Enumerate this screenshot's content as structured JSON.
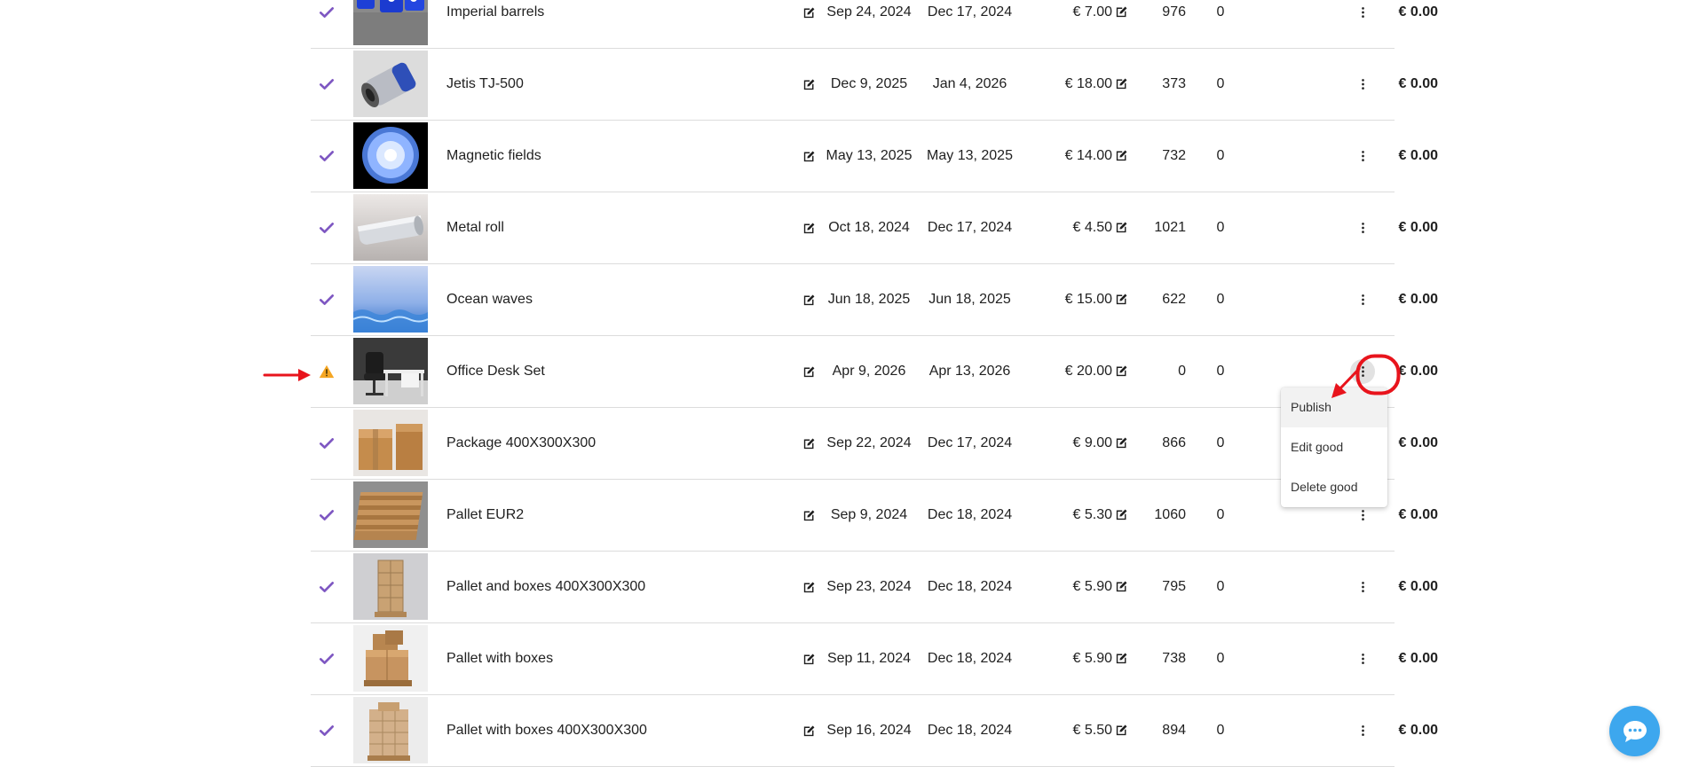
{
  "rows": [
    {
      "status": "published",
      "name": "Imperial barrels",
      "start": "Sep 24, 2024",
      "end": "Dec 17, 2024",
      "price": "€ 7.00",
      "qty": "976",
      "sold": "0",
      "total": "€ 0.00",
      "thumb": "imperial-barrels-thumbnail"
    },
    {
      "status": "published",
      "name": "Jetis TJ-500",
      "start": "Dec 9, 2025",
      "end": "Jan 4, 2026",
      "price": "€ 18.00",
      "qty": "373",
      "sold": "0",
      "total": "€ 0.00",
      "thumb": "jet-engine-thumbnail"
    },
    {
      "status": "published",
      "name": "Magnetic fields",
      "start": "May 13, 2025",
      "end": "May 13, 2025",
      "price": "€ 14.00",
      "qty": "732",
      "sold": "0",
      "total": "€ 0.00",
      "thumb": "magnetic-fields-thumbnail"
    },
    {
      "status": "published",
      "name": "Metal roll",
      "start": "Oct 18, 2024",
      "end": "Dec 17, 2024",
      "price": "€ 4.50",
      "qty": "1021",
      "sold": "0",
      "total": "€ 0.00",
      "thumb": "metal-roll-thumbnail"
    },
    {
      "status": "published",
      "name": "Ocean waves",
      "start": "Jun 18, 2025",
      "end": "Jun 18, 2025",
      "price": "€ 15.00",
      "qty": "622",
      "sold": "0",
      "total": "€ 0.00",
      "thumb": "ocean-waves-thumbnail"
    },
    {
      "status": "warning",
      "name": "Office Desk Set",
      "start": "Apr 9, 2026",
      "end": "Apr 13, 2026",
      "price": "€ 20.00",
      "qty": "0",
      "sold": "0",
      "total": "€ 0.00",
      "thumb": "office-desk-thumbnail"
    },
    {
      "status": "published",
      "name": "Package 400X300X300",
      "start": "Sep 22, 2024",
      "end": "Dec 17, 2024",
      "price": "€ 9.00",
      "qty": "866",
      "sold": "0",
      "total": "€ 0.00",
      "thumb": "package-boxes-thumbnail"
    },
    {
      "status": "published",
      "name": "Pallet EUR2",
      "start": "Sep 9, 2024",
      "end": "Dec 18, 2024",
      "price": "€ 5.30",
      "qty": "1060",
      "sold": "0",
      "total": "€ 0.00",
      "thumb": "pallet-thumbnail"
    },
    {
      "status": "published",
      "name": "Pallet and boxes 400X300X300",
      "start": "Sep 23, 2024",
      "end": "Dec 18, 2024",
      "price": "€ 5.90",
      "qty": "795",
      "sold": "0",
      "total": "€ 0.00",
      "thumb": "pallet-and-boxes-thumbnail"
    },
    {
      "status": "published",
      "name": "Pallet with boxes",
      "start": "Sep 11, 2024",
      "end": "Dec 18, 2024",
      "price": "€ 5.90",
      "qty": "738",
      "sold": "0",
      "total": "€ 0.00",
      "thumb": "pallet-with-boxes-thumbnail"
    },
    {
      "status": "published",
      "name": "Pallet with boxes 400X300X300",
      "start": "Sep 16, 2024",
      "end": "Dec 18, 2024",
      "price": "€ 5.50",
      "qty": "894",
      "sold": "0",
      "total": "€ 0.00",
      "thumb": "pallet-with-boxes-stack-thumbnail"
    }
  ],
  "context_menu": {
    "items": [
      "Publish",
      "Edit good",
      "Delete good"
    ],
    "open_on_row": 5
  },
  "colors": {
    "check": "#7e57c2",
    "warning": "#f5a623",
    "annotation": "#e8141c",
    "chat": "#3da7ee",
    "divider": "#dcdcdc"
  },
  "icons": {
    "status_published": "check-icon",
    "status_warning": "warning-icon",
    "edit": "edit-icon",
    "row_menu": "more-vert-icon",
    "chat": "chat-bubble-icon"
  }
}
